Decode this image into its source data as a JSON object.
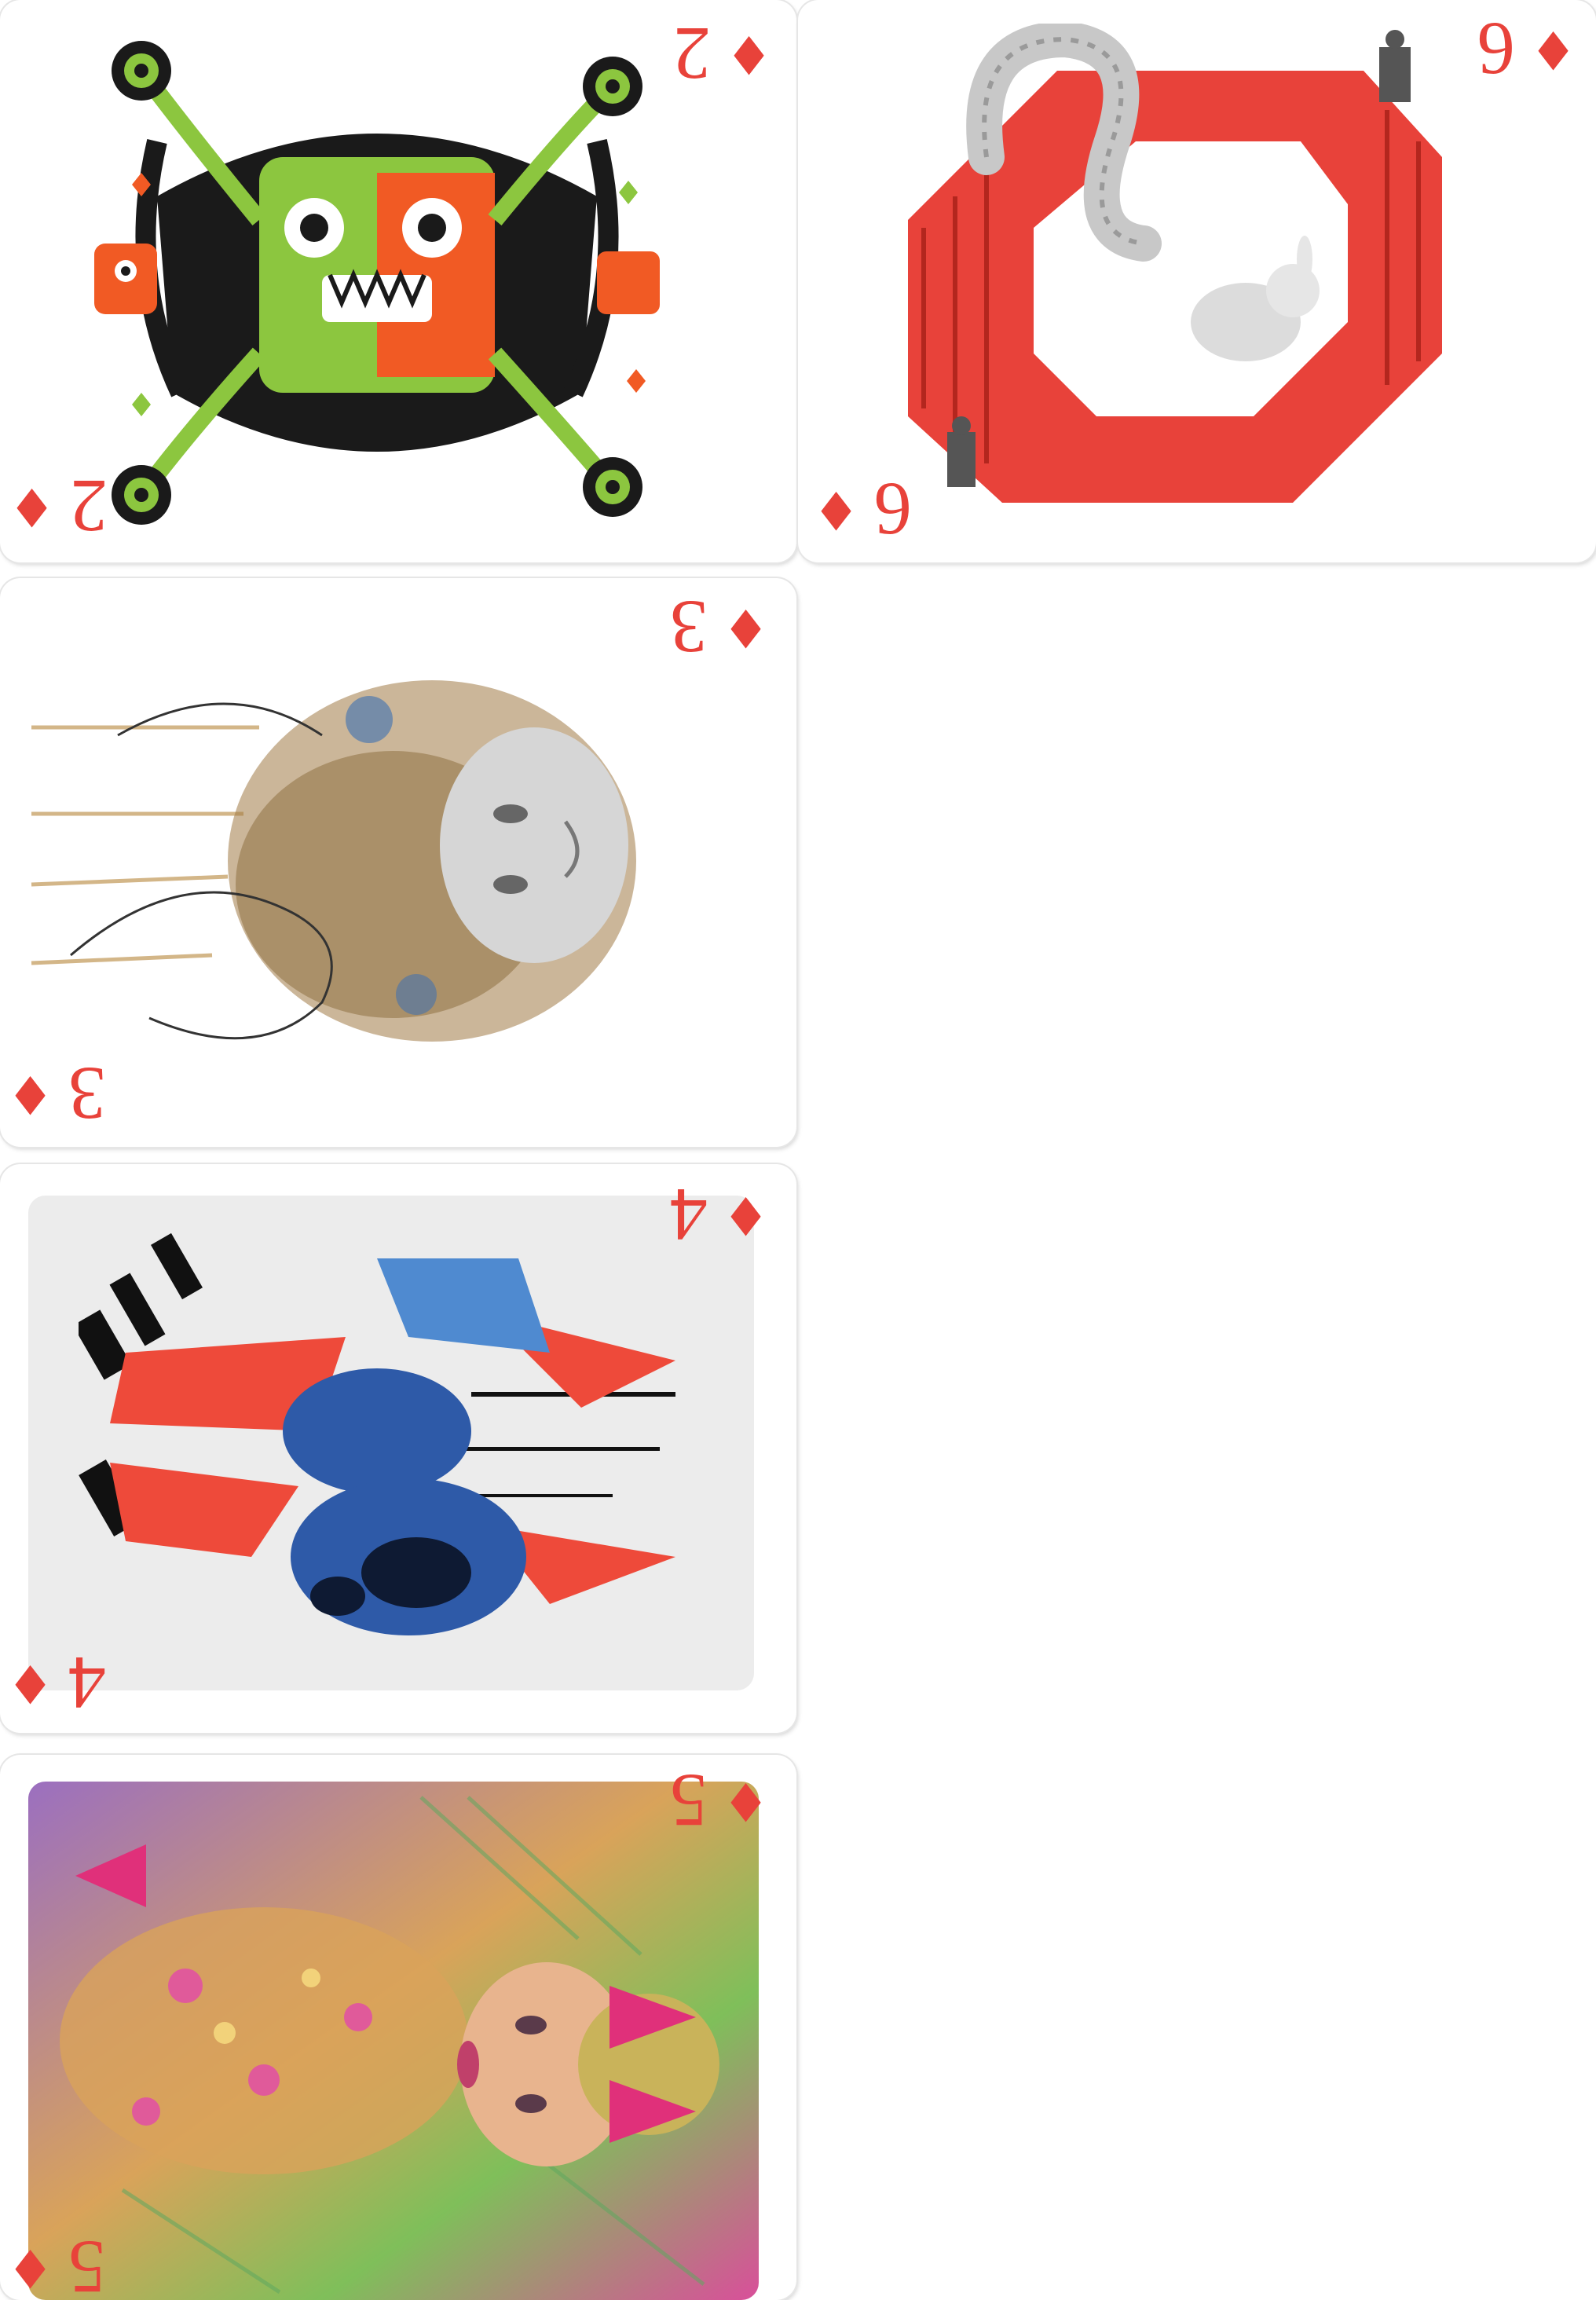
{
  "scan": {
    "cards": [
      {
        "id": "two",
        "rank": "2",
        "suit": "♦",
        "suit_name": "diamonds",
        "art": "green-and-red-monster-collage",
        "colors": [
          "#8cc63f",
          "#f15a24",
          "#1a1a1a"
        ]
      },
      {
        "id": "six",
        "rank": "6",
        "suit": "♦",
        "suit_name": "diamonds",
        "art": "impossible-staircase-with-snake-and-rabbit",
        "colors": [
          "#e8423a",
          "#b0b0b0"
        ]
      },
      {
        "id": "three",
        "rank": "3",
        "suit": "♦",
        "suit_name": "diamonds",
        "art": "ink-splash-portrait",
        "colors": [
          "#8a6a3a",
          "#3c6fb3",
          "#777777"
        ]
      },
      {
        "id": "four",
        "rank": "4",
        "suit": "♦",
        "suit_name": "diamonds",
        "art": "abstract-shards-red-blue",
        "colors": [
          "#ee4a3a",
          "#2e5aa8",
          "#111111"
        ]
      },
      {
        "id": "five",
        "rank": "5",
        "suit": "♦",
        "suit_name": "diamonds",
        "art": "floral-woman-portrait",
        "colors": [
          "#d94f9a",
          "#c9b35a",
          "#7fbf5a"
        ]
      }
    ]
  }
}
